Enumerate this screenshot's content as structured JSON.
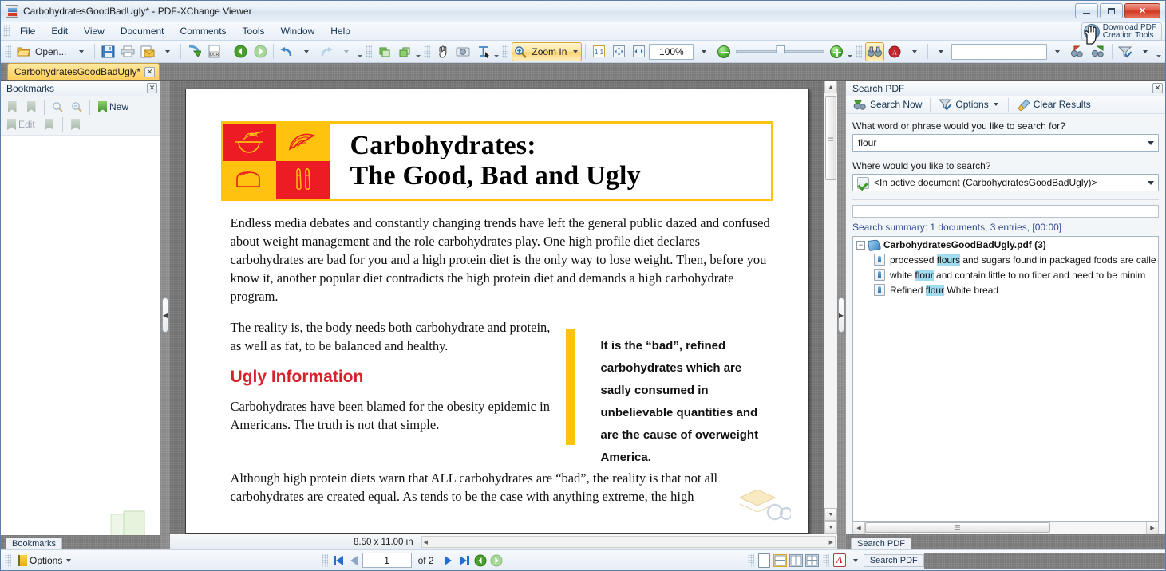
{
  "window": {
    "title": "CarbohydratesGoodBadUgly* - PDF-XChange Viewer",
    "icon": "pdf-document-icon",
    "minimize_label": "–",
    "maximize_label": "□",
    "close_label": "✕"
  },
  "menubar": {
    "items": [
      "File",
      "Edit",
      "View",
      "Document",
      "Comments",
      "Tools",
      "Window",
      "Help"
    ],
    "download_tools": {
      "line1": "Download PDF",
      "line2": "Creation Tools",
      "icon": "globe-download-icon"
    }
  },
  "toolbar": {
    "open_label": "Open...",
    "zoom_in_label": "Zoom In",
    "zoom_value": "100%",
    "search_field_value": "",
    "buttons": [
      {
        "name": "open-button",
        "label": "Open..."
      },
      {
        "name": "save-button",
        "label": ""
      },
      {
        "name": "print-button",
        "label": ""
      },
      {
        "name": "email-button",
        "label": ""
      },
      {
        "name": "export-button",
        "label": ""
      },
      {
        "name": "ocr-button",
        "label": "OCR"
      },
      {
        "name": "previous-view-button",
        "label": ""
      },
      {
        "name": "next-view-button",
        "label": ""
      },
      {
        "name": "undo-button",
        "label": ""
      },
      {
        "name": "redo-button",
        "label": ""
      },
      {
        "name": "rotate-left-button",
        "label": ""
      },
      {
        "name": "rotate-right-button",
        "label": ""
      },
      {
        "name": "hand-tool-button",
        "label": ""
      },
      {
        "name": "snapshot-tool-button",
        "label": ""
      },
      {
        "name": "select-text-tool-button",
        "label": ""
      },
      {
        "name": "zoom-in-button",
        "label": "Zoom In"
      },
      {
        "name": "actual-size-button",
        "label": "1:1"
      },
      {
        "name": "fit-page-button",
        "label": ""
      },
      {
        "name": "fit-width-button",
        "label": ""
      },
      {
        "name": "zoom-out-button",
        "label": ""
      },
      {
        "name": "zoom-increase-button",
        "label": ""
      },
      {
        "name": "find-button",
        "label": ""
      },
      {
        "name": "comment-tool-button",
        "label": ""
      },
      {
        "name": "find-previous-button",
        "label": ""
      },
      {
        "name": "find-next-button",
        "label": ""
      },
      {
        "name": "filter-button",
        "label": ""
      }
    ]
  },
  "doc_tab": {
    "label": "CarbohydratesGoodBadUgly*",
    "close_label": "✕"
  },
  "bookmarks_panel": {
    "title": "Bookmarks",
    "close_label": "✕",
    "new_label": "New",
    "edit_label": "Edit",
    "footer_tab": "Bookmarks"
  },
  "document": {
    "title_line1": "Carbohydrates:",
    "title_line2": "The Good, Bad and Ugly",
    "header_icons": [
      "noodle-bowl-icon",
      "orange-slice-icon",
      "bread-loaf-icon",
      "carrot-sticks-icon"
    ],
    "paragraph1": "Endless media debates and constantly changing trends have left the general public dazed and confused about weight management and the role carbohydrates play. One high profile diet declares carbohydrates are bad for you and a high protein diet is the only way to lose weight. Then, before you know it, another popular diet contradicts the high protein diet and demands a high carbohydrate program.",
    "paragraph2": "The reality is, the body needs both carbohydrate and protein, as well as fat, to be balanced and healthy.",
    "section_heading": "Ugly Information",
    "paragraph3": "Carbohydrates have been blamed for the obesity epidemic in Americans. The truth is not that simple.",
    "paragraph4": "Although high protein diets warn that ALL carbohydrates are “bad”, the reality is that not all carbohydrates are created equal. As tends to be the case with anything extreme, the high",
    "pullquote": "It is the “bad”, refined carbohydrates which are sadly consumed in unbelievable quantities and are the cause of overweight America.",
    "page_size": "8.50 x 11.00 in"
  },
  "search_panel": {
    "title": "Search PDF",
    "close_label": "✕",
    "search_now_label": "Search Now",
    "options_label": "Options",
    "clear_results_label": "Clear Results",
    "question1": "What word or phrase would you like to search for?",
    "query_value": "flour",
    "question2": "Where would you like to search?",
    "scope_value": "<In active document (CarbohydratesGoodBadUgly)>",
    "summary": "Search summary: 1 documents, 3 entries, [00:00]",
    "result_root": "CarbohydratesGoodBadUgly.pdf (3)",
    "results": [
      {
        "pre": "processed ",
        "hit": "flours",
        "post": " and sugars found in packaged foods are calle"
      },
      {
        "pre": "white ",
        "hit": "flour",
        "post": " and contain little to no fiber and need to be minim"
      },
      {
        "pre": "Refined ",
        "hit": "flour",
        "post": " White bread"
      }
    ],
    "footer_tab": "Search PDF",
    "highlight_color": "#9fdcef"
  },
  "bottom_bar": {
    "options_label": "Options",
    "page_number": "1",
    "page_total": "of 2"
  },
  "colors": {
    "doc_red": "#ED1C24",
    "doc_yellow": "#FFC20E",
    "heading_red": "#D8212B",
    "accent_blue": "#2e4a8f"
  }
}
